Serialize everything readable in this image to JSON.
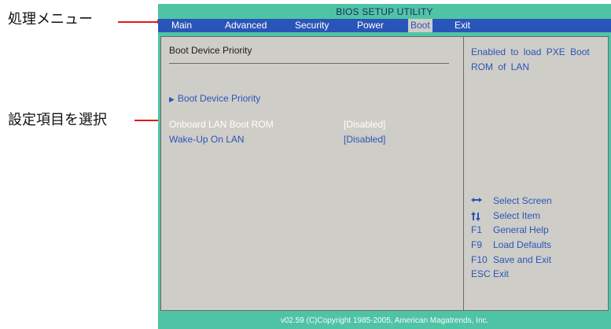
{
  "annotations": {
    "menu_label": "処理メニュー",
    "select_label": "設定項目を選択"
  },
  "bios": {
    "title": "BIOS SETUP UTILITY",
    "menu": [
      "Main",
      "Advanced",
      "Security",
      "Power",
      "Boot",
      "Exit"
    ],
    "active_menu": "Boot",
    "section_title": "Boot Device Priority",
    "submenu_item": "Boot Device Priority",
    "settings": [
      {
        "label": "Onboard LAN Boot ROM",
        "value": "[Disabled]",
        "selected": true
      },
      {
        "label": "Wake-Up On LAN",
        "value": "[Disabled]",
        "selected": false
      }
    ],
    "help_text": "Enabled to load PXE Boot ROM of LAN",
    "keys": [
      {
        "key_icon": "left-right-arrows-icon",
        "desc": "Select Screen"
      },
      {
        "key_icon": "up-down-arrows-icon",
        "desc": "Select Item"
      },
      {
        "key": "F1",
        "desc": "General Help"
      },
      {
        "key": "F9",
        "desc": "Load Defaults"
      },
      {
        "key": "F10",
        "desc": "Save and Exit"
      },
      {
        "key": "ESC",
        "desc": "Exit"
      }
    ],
    "footer": "v02.59 (C)Copyright 1985-2005, American Magatrends, Inc."
  },
  "colors": {
    "bios_bg": "#4fc4a5",
    "menu_bar": "#2a55b8",
    "panel": "#cfcdc8",
    "accent_text": "#2a55b8",
    "callout_line": "#e01a1a"
  }
}
